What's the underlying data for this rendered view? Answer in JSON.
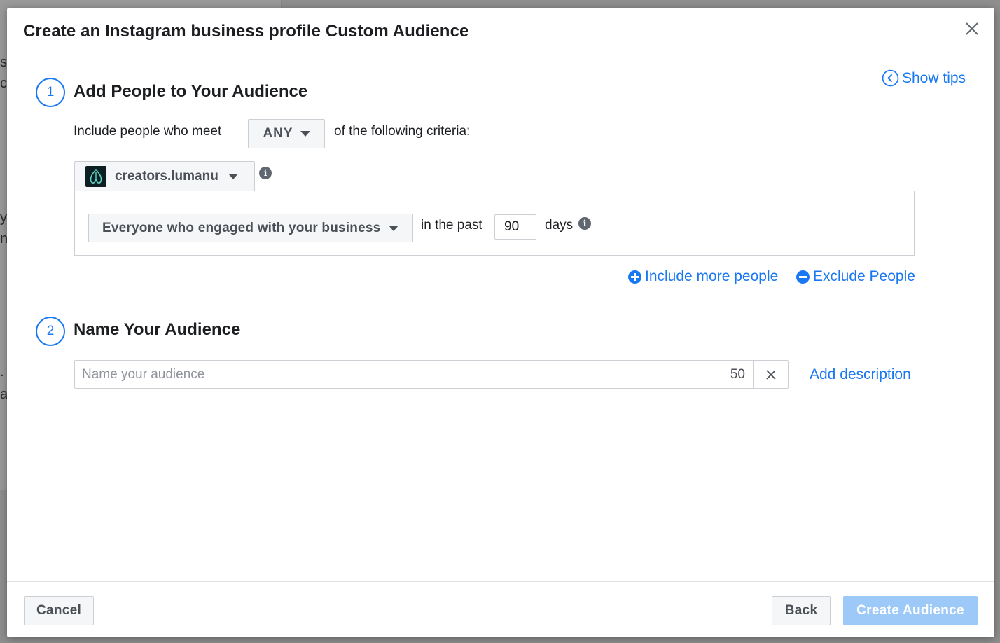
{
  "backdrop": {
    "fragments": [
      "s",
      "c",
      "y",
      "n",
      ".",
      "a"
    ]
  },
  "modal": {
    "title": "Create an Instagram business profile Custom Audience",
    "show_tips": "Show tips"
  },
  "step1": {
    "number": "1",
    "title": "Add People to Your Audience",
    "include_prefix": "Include people who meet",
    "match_value": "ANY",
    "include_suffix": "of the following criteria:",
    "account_name": "creators.lumanu",
    "engagement_option": "Everyone who engaged with your business",
    "in_the_past": "in the past",
    "days_value": "90",
    "days_label": "days",
    "include_more": "Include more people",
    "exclude": "Exclude People"
  },
  "step2": {
    "number": "2",
    "title": "Name Your Audience",
    "name_placeholder": "Name your audience",
    "name_value": "",
    "char_remaining": "50",
    "add_description": "Add description"
  },
  "footer": {
    "cancel": "Cancel",
    "back": "Back",
    "create": "Create Audience"
  },
  "colors": {
    "accent": "#1877f2",
    "disabled_primary": "#9cc9f8"
  }
}
